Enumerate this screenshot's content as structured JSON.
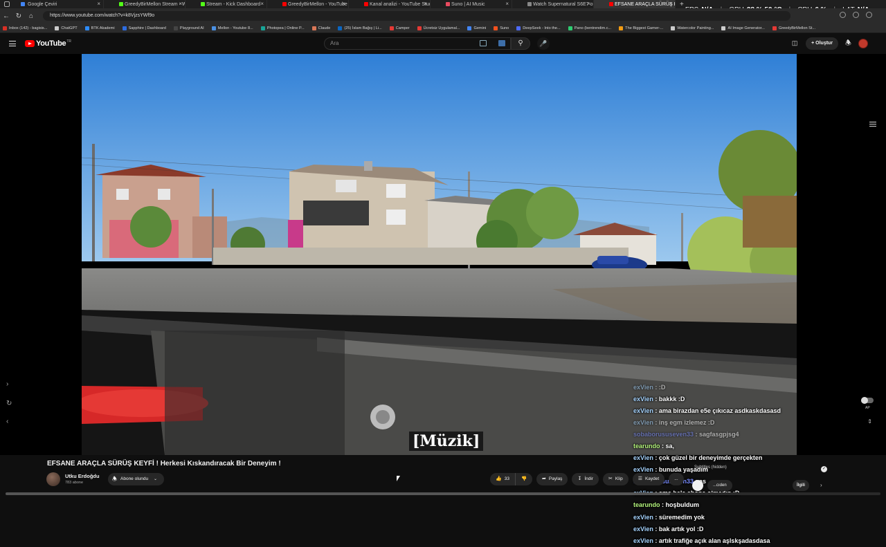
{
  "browser": {
    "tabs": [
      {
        "title": "Google Çeviri",
        "color": "#4285f4"
      },
      {
        "title": "GreedyBirMellon Stream - Watch",
        "color": "#53fc18"
      },
      {
        "title": "Stream - Kick Dashboard",
        "color": "#53fc18"
      },
      {
        "title": "GreedyBirMellon - YouTube",
        "color": "#ff0000"
      },
      {
        "title": "Kanal analizi - YouTube Studio",
        "color": "#ff0000"
      },
      {
        "title": "Suno | AI Music",
        "color": "#e84a5f"
      },
      {
        "title": "Watch Supernatural S6E7 online",
        "color": "#888888"
      },
      {
        "title": "EFSANE ARAÇLA SÜRÜŞ KEYF",
        "color": "#ff0000",
        "active": true
      }
    ],
    "new_tab": "+",
    "url": "https://www.youtube.com/watch?v=k8VjzsYWf9o",
    "bookmarks": [
      {
        "label": "Inbox (142) - bagisis...",
        "color": "#d93025"
      },
      {
        "label": "ChatGPT",
        "color": "#cccccc"
      },
      {
        "label": "BTK Akademi",
        "color": "#2d8cff"
      },
      {
        "label": "Sapphire | Dashboard",
        "color": "#2d6cdf"
      },
      {
        "label": "Playground AI",
        "color": "#444444"
      },
      {
        "label": "Mellon - Youtube 8...",
        "color": "#4a90e2"
      },
      {
        "label": "Photopea | Online P...",
        "color": "#18a497"
      },
      {
        "label": "Claude",
        "color": "#d97757"
      },
      {
        "label": "(25) İslam Bağış | Li...",
        "color": "#0a66c2"
      },
      {
        "label": "Camper",
        "color": "#e53935"
      },
      {
        "label": "Ücretsiz Uygulamal...",
        "color": "#e53935"
      },
      {
        "label": "Gemini",
        "color": "#4285f4"
      },
      {
        "label": "Suno",
        "color": "#f4511e"
      },
      {
        "label": "DeepSeek - Into the...",
        "color": "#4d6bfe"
      },
      {
        "label": "Pano (bentrendim.c...",
        "color": "#2ecc71"
      },
      {
        "label": "The Biggest Gamer-...",
        "color": "#f39c12"
      },
      {
        "label": "Watercolor Painting...",
        "color": "#cccccc"
      },
      {
        "label": "AI Image Generator...",
        "color": "#cccccc"
      },
      {
        "label": "GreedyBirMellon St...",
        "color": "#e53935"
      }
    ]
  },
  "overlay_stats": {
    "fps_label": "FPS",
    "fps_value": "N/A",
    "gpu_label": "GPU",
    "gpu_value": "28 % 50 °C",
    "cpu_label": "CPU",
    "cpu_value": "6 %",
    "lat_label": "LAT",
    "lat_value": "N/A"
  },
  "youtube": {
    "logo_text": "YouTube",
    "logo_country": "TR",
    "search_placeholder": "Ara",
    "create_label": "Oluştur"
  },
  "video": {
    "caption": "[Müzik]",
    "chat": [
      {
        "user": "exVien",
        "text": ":D",
        "dim": true
      },
      {
        "user": "exVien",
        "text": "bakkk :D"
      },
      {
        "user": "exVien",
        "text": "ama birazdan e5e çıkıcaz asdkaskdasasd"
      },
      {
        "user": "exVien",
        "text": "inş egm izlemez :D",
        "dim": true
      },
      {
        "user": "sobaborususeven33",
        "text": "sagfasgpjsg4",
        "dim": true
      },
      {
        "user": "tearundo",
        "text": "sa,"
      },
      {
        "user": "exVien",
        "text": "çok güzel bir deneyimde gerçekten"
      },
      {
        "user": "exVien",
        "text": "bunuda yaşadım"
      },
      {
        "user": "sobaborususeven33",
        "text": "as"
      },
      {
        "user": "exVien",
        "text": "ama hala abone olmadın :D"
      },
      {
        "user": "tearundo",
        "text": "hoşbuldum"
      },
      {
        "user": "exVien",
        "text": "süremedim yok"
      },
      {
        "user": "exVien",
        "text": "bak artık yol :D"
      },
      {
        "user": "exVien",
        "text": "artık trafiğe açık alan aşlskşadasdasa"
      }
    ],
    "autoplay_label": "AP"
  },
  "details": {
    "title": "EFSANE ARAÇLA SÜRÜŞ KEYFİ ! Herkesi Kıskandıracak Bir Deneyim !",
    "channel_name": "Utku Erdoğdu",
    "subscribers": "783 abone",
    "subscribe_label": "Abone olundu",
    "like_count": "33",
    "share_label": "Paylaş",
    "download_label": "İndir",
    "clip_label": "Klip",
    "save_label": "Kaydet",
    "more_label": "...",
    "subtitles_status": "Subtitles (hidden)",
    "chips": [
      "",
      "...cıden"
    ],
    "related_label": "İlgili"
  }
}
